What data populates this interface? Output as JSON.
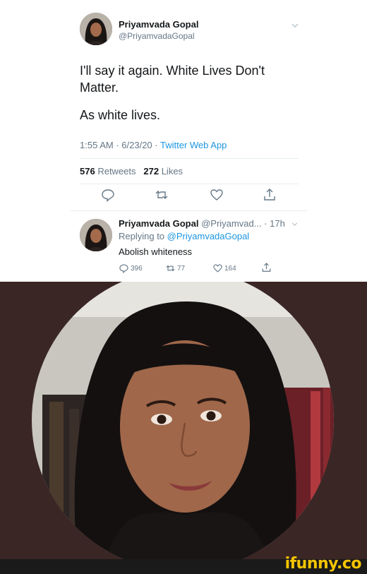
{
  "tweet": {
    "display_name": "Priyamvada Gopal",
    "handle": "@PriyamvadaGopal",
    "line1": "I'll say it again. White Lives Don't Matter.",
    "line2": "As white lives.",
    "time": "1:55 AM",
    "date": "6/23/20",
    "app": "Twitter Web App",
    "retweets_count": "576",
    "retweets_label": "Retweets",
    "likes_count": "272",
    "likes_label": "Likes",
    "icons": [
      "reply-icon",
      "retweet-icon",
      "like-icon",
      "share-icon"
    ]
  },
  "reply": {
    "display_name": "Priyamvada Gopal",
    "handle_trunc": "@Priyamvad...",
    "age": "17h",
    "replying_prefix": "Replying to",
    "replying_handle": "@PriyamvadaGopal",
    "text": "Abolish whiteness",
    "replies": "396",
    "retweets": "77",
    "likes": "164"
  },
  "watermark": "ifunny.co",
  "colors": {
    "link": "#1b95e0",
    "secondary": "#657786",
    "photo_background": "#3a2625",
    "watermark": "#f5c400"
  }
}
